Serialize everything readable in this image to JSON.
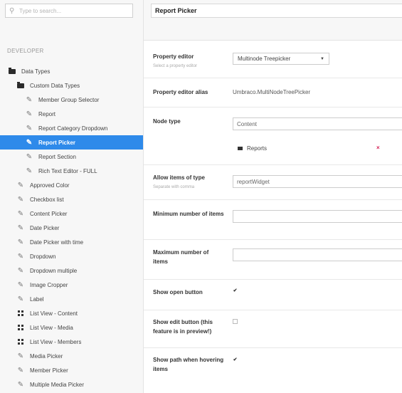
{
  "search": {
    "placeholder": "Type to search..."
  },
  "sidebar": {
    "section": "DEVELOPER",
    "items": [
      {
        "label": "Data Types",
        "icon": "folder-icon",
        "indent": 0
      },
      {
        "label": "Custom Data Types",
        "icon": "folder-icon",
        "indent": 1
      },
      {
        "label": "Member Group Selector",
        "icon": "pencil-icon",
        "indent": 2
      },
      {
        "label": "Report",
        "icon": "pencil-icon",
        "indent": 2
      },
      {
        "label": "Report Category Dropdown",
        "icon": "pencil-icon",
        "indent": 2
      },
      {
        "label": "Report Picker",
        "icon": "pencil-icon",
        "indent": 2,
        "active": true
      },
      {
        "label": "Report Section",
        "icon": "pencil-icon",
        "indent": 2
      },
      {
        "label": "Rich Text Editor - FULL",
        "icon": "pencil-icon",
        "indent": 2
      },
      {
        "label": "Approved Color",
        "icon": "pencil-icon",
        "indent": 1
      },
      {
        "label": "Checkbox list",
        "icon": "pencil-icon",
        "indent": 1
      },
      {
        "label": "Content Picker",
        "icon": "pencil-icon",
        "indent": 1
      },
      {
        "label": "Date Picker",
        "icon": "pencil-icon",
        "indent": 1
      },
      {
        "label": "Date Picker with time",
        "icon": "pencil-icon",
        "indent": 1
      },
      {
        "label": "Dropdown",
        "icon": "pencil-icon",
        "indent": 1
      },
      {
        "label": "Dropdown multiple",
        "icon": "pencil-icon",
        "indent": 1
      },
      {
        "label": "Image Cropper",
        "icon": "pencil-icon",
        "indent": 1
      },
      {
        "label": "Label",
        "icon": "pencil-icon",
        "indent": 1
      },
      {
        "label": "List View - Content",
        "icon": "grid-icon",
        "indent": 1
      },
      {
        "label": "List View - Media",
        "icon": "grid-icon",
        "indent": 1
      },
      {
        "label": "List View - Members",
        "icon": "grid-icon",
        "indent": 1
      },
      {
        "label": "Media Picker",
        "icon": "pencil-icon",
        "indent": 1
      },
      {
        "label": "Member Picker",
        "icon": "pencil-icon",
        "indent": 1
      },
      {
        "label": "Multiple Media Picker",
        "icon": "pencil-icon",
        "indent": 1
      }
    ]
  },
  "header": {
    "title": "Report Picker"
  },
  "form": {
    "property_editor": {
      "label": "Property editor",
      "desc": "Select a property editor",
      "value": "Multinode Treepicker"
    },
    "alias": {
      "label": "Property editor alias",
      "value": "Umbraco.MultiNodeTreePicker"
    },
    "node_type": {
      "label": "Node type",
      "value": "Content",
      "node": "Reports",
      "remove": "×"
    },
    "allow_items": {
      "label": "Allow items of type",
      "desc": "Separate with comma",
      "value": "reportWidget"
    },
    "min_items": {
      "label": "Minimum number of items",
      "value": ""
    },
    "max_items": {
      "label": "Maximum number of items",
      "value": ""
    },
    "show_open": {
      "label": "Show open button",
      "checked": true
    },
    "show_edit": {
      "label": "Show edit button (this feature is in preview!)",
      "checked": false
    },
    "show_path": {
      "label": "Show path when hovering items",
      "checked": true
    }
  },
  "colors": {
    "accent": "#2e8aea",
    "remove": "#d42054"
  }
}
